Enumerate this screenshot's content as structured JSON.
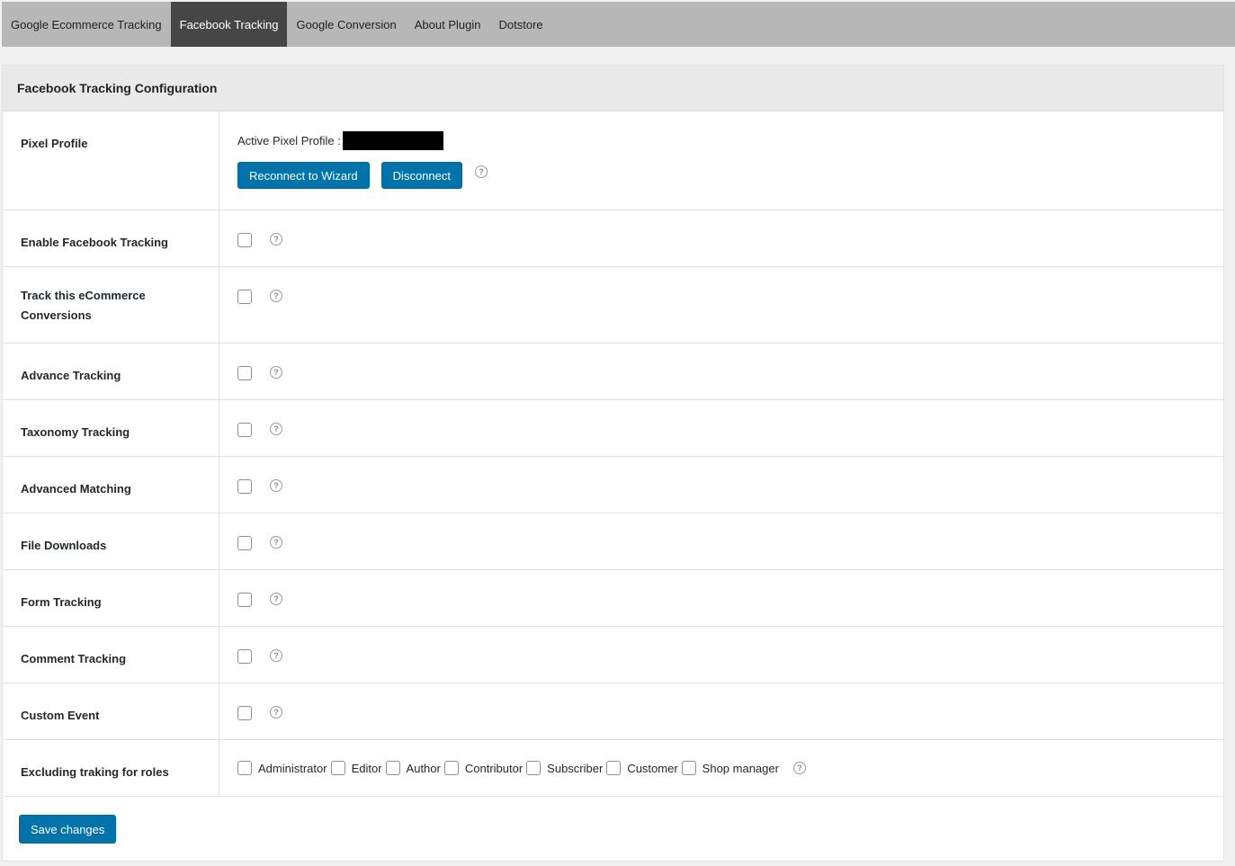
{
  "tabs": [
    {
      "label": "Google Ecommerce Tracking",
      "active": false
    },
    {
      "label": "Facebook Tracking",
      "active": true
    },
    {
      "label": "Google Conversion",
      "active": false
    },
    {
      "label": "About Plugin",
      "active": false
    },
    {
      "label": "Dotstore",
      "active": false
    }
  ],
  "panel": {
    "title": "Facebook Tracking Configuration"
  },
  "pixel": {
    "label": "Pixel Profile",
    "active_label": "Active Pixel Profile :",
    "reconnect_label": "Reconnect to Wizard",
    "disconnect_label": "Disconnect"
  },
  "rows": [
    {
      "label": "Enable Facebook Tracking"
    },
    {
      "label": "Track this eCommerce Conversions"
    },
    {
      "label": "Advance Tracking"
    },
    {
      "label": "Taxonomy Tracking"
    },
    {
      "label": "Advanced Matching"
    },
    {
      "label": "File Downloads"
    },
    {
      "label": "Form Tracking"
    },
    {
      "label": "Comment Tracking"
    },
    {
      "label": "Custom Event"
    }
  ],
  "roles": {
    "label": "Excluding traking for roles",
    "items": [
      "Administrator",
      "Editor",
      "Author",
      "Contributor",
      "Subscriber",
      "Customer",
      "Shop manager"
    ]
  },
  "footer": {
    "save_label": "Save changes"
  },
  "colors": {
    "accent": "#0073aa",
    "tab_active": "#464646",
    "tab_bar": "#b7b7b7"
  },
  "icons": {
    "help": "question-circle-icon",
    "checkbox": "checkbox-unchecked"
  }
}
